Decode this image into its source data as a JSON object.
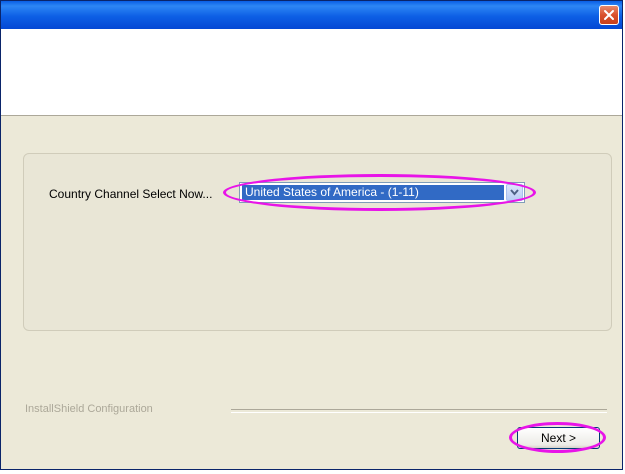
{
  "window": {
    "title": "",
    "close_icon": "close-icon"
  },
  "banner": {
    "title": ""
  },
  "country": {
    "label": "Country Channel Select Now...",
    "selected_value": "United States of America - (1-11)",
    "dropdown_icon": "chevron-down-icon"
  },
  "footer": {
    "brand": "InstallShield Configuration",
    "next_label": "Next >"
  },
  "colors": {
    "titlebar": "#0d5fe5",
    "dialog_bg": "#ece9d8",
    "selection": "#316ac5",
    "highlight_ring": "#e814e8",
    "close_button": "#d9502c"
  }
}
